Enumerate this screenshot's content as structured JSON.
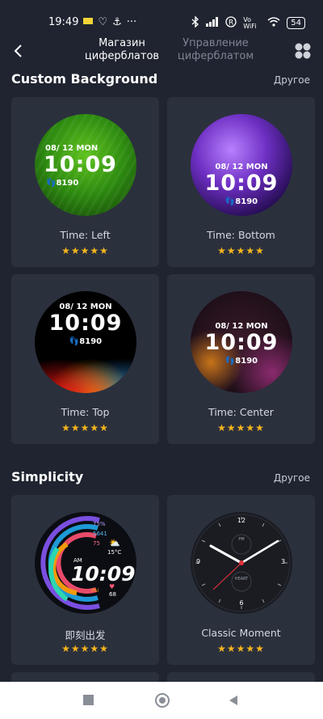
{
  "status": {
    "time": "19:49",
    "icons_left": [
      "sim-card-icon",
      "heart-monitor-icon",
      "boat-icon",
      "more-dots-icon"
    ],
    "icons_right": [
      "bluetooth-icon",
      "signal-icon",
      "r-icon",
      "volte-icon",
      "wifi-icon"
    ],
    "volte": "Vo WiFi",
    "battery": "54"
  },
  "nav": {
    "tab_active": "Магазин циферблатов",
    "tab_inactive": "Управление циферблатом"
  },
  "sections": [
    {
      "title": "Custom Background",
      "more": "Другое"
    },
    {
      "title": "Simplicity",
      "more": "Другое"
    }
  ],
  "cards": [
    {
      "label": "Time: Left",
      "stars": "★★★★★",
      "date": "08/ 12  MON",
      "time": "10:09",
      "steps": "8190"
    },
    {
      "label": "Time: Bottom",
      "stars": "★★★★★",
      "date": "08/ 12  MON",
      "time": "10:09",
      "steps": "8190"
    },
    {
      "label": "Time: Top",
      "stars": "★★★★★",
      "date": "08/ 12  MON",
      "time": "10:09",
      "steps": "8190"
    },
    {
      "label": "Time: Center",
      "stars": "★★★★★",
      "date": "08/ 12  MON",
      "time": "10:09",
      "steps": "8190"
    },
    {
      "label": "即刻出发",
      "stars": "★★★★★",
      "time": "10:09",
      "ampm": "AM",
      "temp": "15°C",
      "ring_values": [
        "75%",
        "5641",
        "75"
      ],
      "pai": "PAI",
      "heart": "68"
    },
    {
      "label": "Classic Moment",
      "stars": "★★★★★",
      "numerals": [
        "12",
        "3",
        "6",
        "9"
      ],
      "pm": "PM",
      "heart": "HEART"
    }
  ],
  "colors": {
    "background": "#1f2430",
    "card": "#2b303d",
    "star": "#f5b51d",
    "muted": "#7e8494"
  }
}
